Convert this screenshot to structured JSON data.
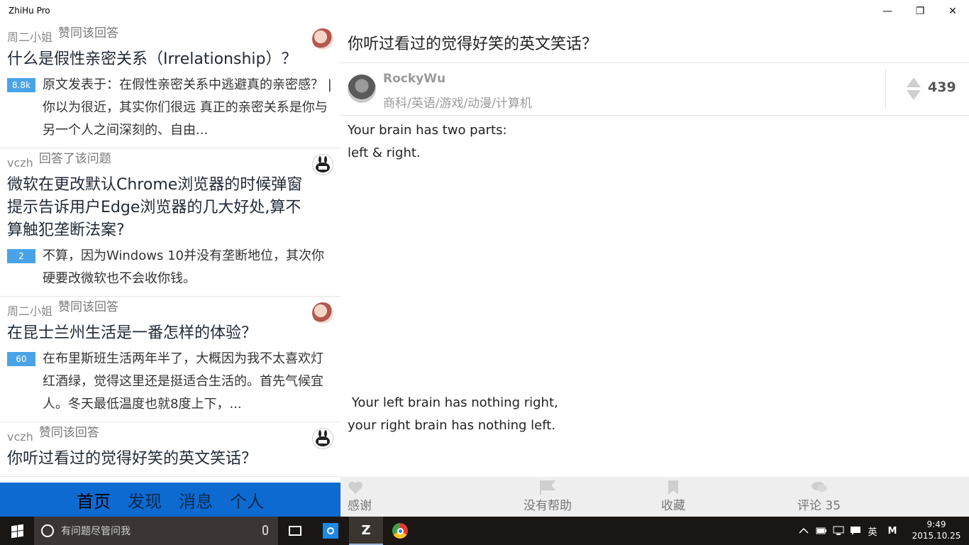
{
  "window": {
    "title": "ZhiHu Pro",
    "minimize": "—",
    "maximize": "❐",
    "close": "✕"
  },
  "feed": [
    {
      "user": "周二小姐",
      "action": "赞同该回答",
      "avatar": "avatar-girl",
      "title": "什么是假性亲密关系（Irrelationship）？",
      "votes": "8.8k",
      "excerpt": "原文发表于：在假性亲密关系中逃避真的亲密感？ | 你以为很近，其实你们很远 真正的亲密关系是你与另一个人之间深刻的、自由..."
    },
    {
      "user": "vczh",
      "action": "回答了该问题",
      "avatar": "avatar-bunny",
      "title": "微软在更改默认Chrome浏览器的时候弹窗提示告诉用户Edge浏览器的几大好处,算不算触犯垄断法案?",
      "votes": "2",
      "excerpt": "不算，因为Windows 10并没有垄断地位，其次你硬要改微软也不会收你钱。"
    },
    {
      "user": "周二小姐",
      "action": "赞同该回答",
      "avatar": "avatar-girl",
      "title": "在昆士兰州生活是一番怎样的体验？",
      "votes": "60",
      "excerpt": "在布里斯班生活两年半了，大概因为我不太喜欢灯红酒绿，觉得这里还是挺适合生活的。首先气候宜人。冬天最低温度也就8度上下，..."
    },
    {
      "user": "vczh",
      "action": "赞同该回答",
      "avatar": "avatar-bunny",
      "title": "你听过看过的觉得好笑的英文笑话？",
      "votes": "",
      "excerpt": ""
    }
  ],
  "nav": {
    "home": "首页",
    "discover": "发现",
    "messages": "消息",
    "profile": "个人"
  },
  "detail": {
    "question": "你听过看过的觉得好笑的英文笑话？",
    "author_name": "RockyWu",
    "author_bio": "商科/英语/游戏/动漫/计算机",
    "vote_count": "439",
    "p1_line1": "Your brain has two parts:",
    "p1_line2": "left & right.",
    "p2_line1": " Your left brain has nothing right,",
    "p2_line2": "your right brain has nothing left."
  },
  "actions": {
    "thanks": "感谢",
    "no_help": "没有帮助",
    "favorite": "收藏",
    "comments": "评论 35"
  },
  "taskbar": {
    "search_placeholder": "有问题尽管问我",
    "ime": "英",
    "m_label": "M",
    "time": "9:49",
    "date": "2015.10.25"
  },
  "colors": {
    "nav_bg": "#0d6ad1",
    "badge": "#4aa3e6"
  }
}
